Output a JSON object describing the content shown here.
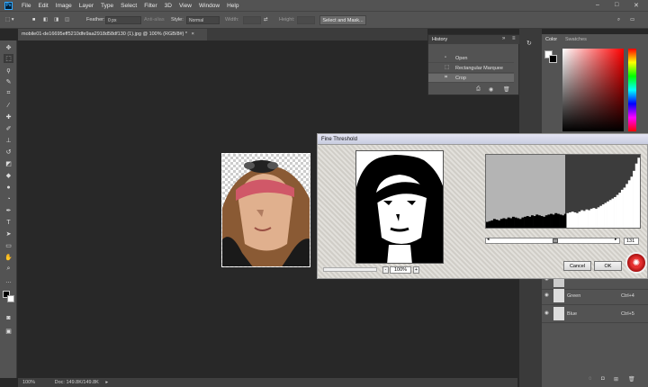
{
  "menubar": {
    "logo": "Ps",
    "items": [
      "File",
      "Edit",
      "Image",
      "Layer",
      "Type",
      "Select",
      "Filter",
      "3D",
      "View",
      "Window",
      "Help"
    ]
  },
  "options": {
    "feather_label": "Feather:",
    "feather_value": "0 px",
    "antialias_label": "Anti-alias",
    "style_label": "Style:",
    "style_value": "Normal",
    "width_label": "Width:",
    "height_label": "Height:",
    "select_mask_label": "Select and Mask..."
  },
  "document": {
    "tab_title": "mobile01-de16695eff5210dfe9aa2918d58df130 (1).jpg @ 100% (RGB/8#) *",
    "close_glyph": "×"
  },
  "history": {
    "tab_label": "History",
    "items": [
      {
        "label": "Open",
        "icon": "document-icon"
      },
      {
        "label": "Rectangular Marquee",
        "icon": "marquee-icon"
      },
      {
        "label": "Crop",
        "icon": "crop-icon"
      }
    ]
  },
  "color_panel": {
    "tab_color": "Color",
    "tab_swatches": "Swatches"
  },
  "channels": [
    {
      "name": "Green",
      "shortcut": "Ctrl+4"
    },
    {
      "name": "Blue",
      "shortcut": "Ctrl+5"
    }
  ],
  "dialog": {
    "title": "Fine Threshold",
    "threshold_value": "131",
    "zoom_value": "100%",
    "cancel_label": "Cancel",
    "ok_label": "OK",
    "zoom_minus": "-",
    "zoom_plus": "+",
    "histogram": {
      "type": "area",
      "levels": [
        8,
        9,
        10,
        12,
        11,
        10,
        12,
        13,
        12,
        14,
        13,
        15,
        14,
        13,
        12,
        14,
        15,
        16,
        15,
        17,
        16,
        18,
        17,
        16,
        15,
        17,
        18,
        19,
        18,
        20,
        19,
        18,
        17,
        19,
        20,
        21,
        22,
        21,
        20,
        22,
        24,
        23,
        25,
        24,
        26,
        27,
        26,
        28,
        30,
        32,
        34,
        36,
        38,
        40,
        42,
        45,
        48,
        52,
        55,
        60,
        65,
        70,
        78,
        88,
        96
      ]
    }
  },
  "status": {
    "zoom": "100%",
    "doc": "Doc: 149.8K/149.8K"
  },
  "colors": {
    "app_bg": "#282828",
    "panel_bg": "#535353",
    "dialog_bg": "#d8d5cf"
  }
}
